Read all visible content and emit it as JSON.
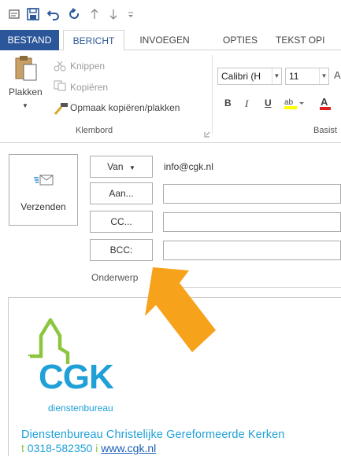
{
  "colors": {
    "accent": "#2b579a",
    "cgk_blue": "#1fa0d6",
    "cgk_green": "#8cc63f",
    "arrow": "#f7a21b"
  },
  "qat": {
    "icons": [
      "mail-icon",
      "save-icon",
      "undo-icon",
      "redo-icon",
      "up-arrow-icon",
      "down-arrow-icon",
      "customize-icon"
    ]
  },
  "tabs": [
    "BESTAND",
    "BERICHT",
    "INVOEGEN",
    "OPTIES",
    "TEKST OPI"
  ],
  "ribbon": {
    "paste_label": "Plakken",
    "cut_label": "Knippen",
    "copy_label": "Kopiëren",
    "format_painter_label": "Opmaak kopiëren/plakken",
    "clipboard_group": "Klembord",
    "font_name": "Calibri (H",
    "font_size": "11",
    "basic_text_group": "Basist",
    "bold": "B",
    "italic": "I",
    "underline": "U"
  },
  "compose": {
    "send_label": "Verzenden",
    "from_label": "Van",
    "from_value": "info@cgk.nl",
    "to_label": "Aan...",
    "cc_label": "CC...",
    "bcc_label": "BCC:",
    "subject_label": "Onderwerp"
  },
  "signature": {
    "logo_text": "CGK",
    "logo_sub": "dienstenbureau",
    "line1": "Dienstenbureau Christelijke Gereformeerde Kerken",
    "phone_prefix": "t",
    "phone": "0318-582350",
    "sep": "i",
    "website": "www.cgk.nl"
  }
}
